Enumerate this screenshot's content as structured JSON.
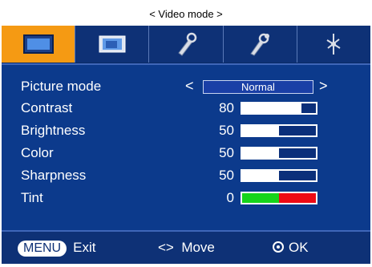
{
  "caption": "< Video mode >",
  "tabs": [
    {
      "name": "video-tab",
      "icon": "screen-icon",
      "active": true
    },
    {
      "name": "screen-tab",
      "icon": "inner-screen-icon",
      "active": false
    },
    {
      "name": "tool-tab",
      "icon": "wrench-icon",
      "active": false
    },
    {
      "name": "option-tab",
      "icon": "tools-icon",
      "active": false
    },
    {
      "name": "setup-tab",
      "icon": "pointer-icon",
      "active": false
    }
  ],
  "settings": {
    "picture_mode": {
      "label": "Picture mode",
      "value": "Normal",
      "left_arrow": "<",
      "right_arrow": ">"
    },
    "contrast": {
      "label": "Contrast",
      "value": "80",
      "level": 0.8
    },
    "brightness": {
      "label": "Brightness",
      "value": "50",
      "level": 0.5
    },
    "color": {
      "label": "Color",
      "value": "50",
      "level": 0.5
    },
    "sharpness": {
      "label": "Sharpness",
      "value": "50",
      "level": 0.5
    },
    "tint": {
      "label": "Tint",
      "value": "0",
      "green_fraction": 0.5
    }
  },
  "footer": {
    "menu_key": "MENU",
    "exit_label": "Exit",
    "move_symbol": "<>",
    "move_label": "Move",
    "ok_label": "OK"
  },
  "colors": {
    "active_tab": "#f59a13",
    "panel": "#0c3a8c",
    "tint_green": "#16d41a",
    "tint_red": "#ee0a14"
  }
}
